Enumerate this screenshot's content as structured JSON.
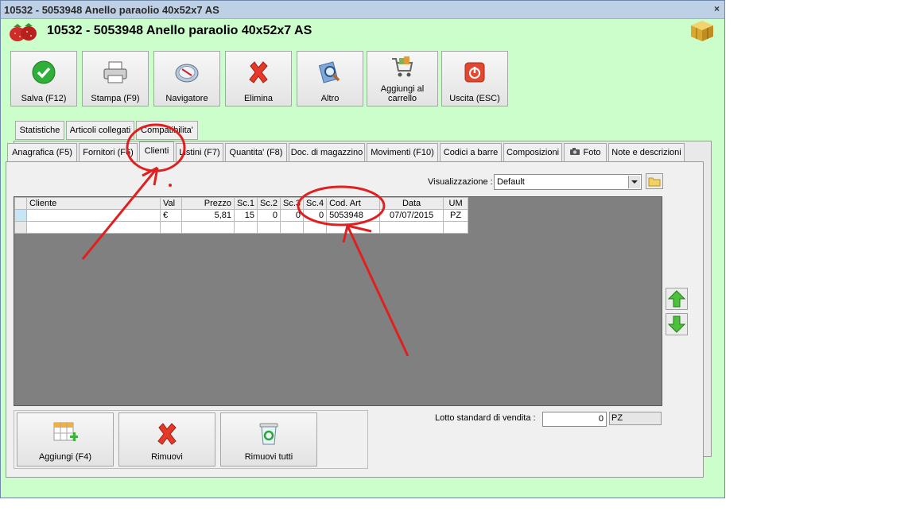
{
  "window": {
    "title": "10532 - 5053948 Anello paraolio 40x52x7 AS",
    "close_glyph": "×",
    "header_title": "10532 - 5053948 Anello paraolio 40x52x7 AS"
  },
  "toolbar": [
    {
      "label": "Salva (F12)",
      "icon": "check-icon"
    },
    {
      "label": "Stampa (F9)",
      "icon": "printer-icon"
    },
    {
      "label": "Navigatore",
      "icon": "compass-icon"
    },
    {
      "label": "Elimina",
      "icon": "delete-x-icon"
    },
    {
      "label": "Altro",
      "icon": "magnifier-icon"
    },
    {
      "label": "Aggiungi al carrello",
      "icon": "cart-icon"
    },
    {
      "label": "Uscita (ESC)",
      "icon": "power-icon"
    }
  ],
  "tabs_top": [
    "Statistiche",
    "Articoli collegati",
    "Compatibilita'"
  ],
  "tabs_main": [
    "Anagrafica (F5)",
    "Fornitori (F6)",
    "Clienti",
    "Listini (F7)",
    "Quantita' (F8)",
    "Doc. di magazzino",
    "Movimenti (F10)",
    "Codici a barre",
    "Composizioni",
    "Foto",
    "Note e descrizioni"
  ],
  "active_tab": "Clienti",
  "view": {
    "label": "Visualizzazione :",
    "value": "Default"
  },
  "table": {
    "columns": [
      "Cliente",
      "Val",
      "Prezzo",
      "Sc.1",
      "Sc.2",
      "Sc.3",
      "Sc.4",
      "Cod. Art",
      "Data",
      "UM"
    ],
    "rows": [
      {
        "cliente": "",
        "val": "€",
        "prezzo": "5,81",
        "sc1": "15",
        "sc2": "0",
        "sc3": "0",
        "sc4": "0",
        "codart": "5053948",
        "data": "07/07/2015",
        "um": "PZ"
      }
    ]
  },
  "bottom_buttons": [
    {
      "label": "Aggiungi (F4)",
      "icon": "grid-add-icon"
    },
    {
      "label": "Rimuovi",
      "icon": "delete-x-icon"
    },
    {
      "label": "Rimuovi tutti",
      "icon": "recycle-bin-icon"
    }
  ],
  "lotto": {
    "label": "Lotto standard di vendita :",
    "value": "0",
    "unit": "PZ"
  },
  "annotation_color": "#e02020"
}
